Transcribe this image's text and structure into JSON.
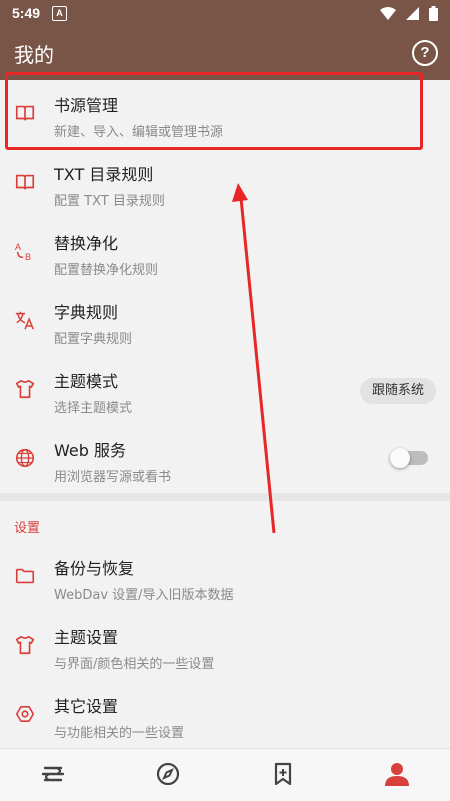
{
  "statusbar": {
    "time": "5:49",
    "notif_badge": "A"
  },
  "appbar": {
    "title": "我的"
  },
  "items": [
    {
      "label": "书源管理",
      "sub": "新建、导入、编辑或管理书源",
      "icon": "book-icon"
    },
    {
      "label": "TXT 目录规则",
      "sub": "配置 TXT 目录规则",
      "icon": "book-icon"
    },
    {
      "label": "替换净化",
      "sub": "配置替换净化规则",
      "icon": "replace-icon"
    },
    {
      "label": "字典规则",
      "sub": "配置字典规则",
      "icon": "translate-icon"
    },
    {
      "label": "主题模式",
      "sub": "选择主题模式",
      "icon": "shirt-icon",
      "value": "跟随系统"
    },
    {
      "label": "Web 服务",
      "sub": "用浏览器写源或看书",
      "icon": "globe-icon",
      "toggle_on": false
    }
  ],
  "section_title": "设置",
  "settings": [
    {
      "label": "备份与恢复",
      "sub": "WebDav 设置/导入旧版本数据",
      "icon": "folder-icon"
    },
    {
      "label": "主题设置",
      "sub": "与界面/颜色相关的一些设置",
      "icon": "shirt-icon"
    },
    {
      "label": "其它设置",
      "sub": "与功能相关的一些设置",
      "icon": "gear-icon"
    }
  ],
  "nav": [
    "bookshelf-icon",
    "explore-icon",
    "rss-icon",
    "profile-icon"
  ],
  "colors": {
    "primary": "#795548",
    "accent": "#d8403c",
    "annotation": "#e82626"
  }
}
